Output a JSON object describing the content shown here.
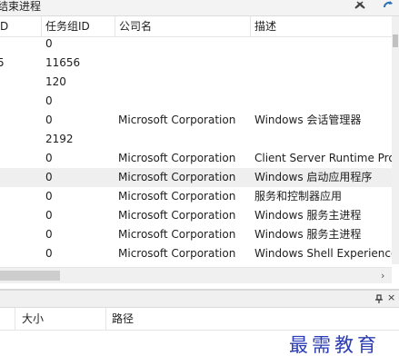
{
  "toolbar": {
    "label": "结束进程",
    "icons": [
      "kill-process-icon",
      "refresh-icon"
    ]
  },
  "table": {
    "columns": [
      "D",
      "任务组ID",
      "公司名",
      "描述"
    ],
    "rows": [
      {
        "id": "",
        "task_group": "0",
        "company": "",
        "description": ""
      },
      {
        "id": "5",
        "task_group": "11656",
        "company": "",
        "description": ""
      },
      {
        "id": "",
        "task_group": "120",
        "company": "",
        "description": ""
      },
      {
        "id": "",
        "task_group": "0",
        "company": "",
        "description": ""
      },
      {
        "id": "",
        "task_group": "0",
        "company": "Microsoft Corporation",
        "description": "Windows 会话管理器"
      },
      {
        "id": "",
        "task_group": "2192",
        "company": "",
        "description": ""
      },
      {
        "id": "",
        "task_group": "0",
        "company": "Microsoft Corporation",
        "description": "Client Server Runtime Process"
      },
      {
        "id": "",
        "task_group": "0",
        "company": "Microsoft Corporation",
        "description": "Windows 启动应用程序"
      },
      {
        "id": "",
        "task_group": "0",
        "company": "Microsoft Corporation",
        "description": "服务和控制器应用"
      },
      {
        "id": "",
        "task_group": "0",
        "company": "Microsoft Corporation",
        "description": "Windows 服务主进程"
      },
      {
        "id": "",
        "task_group": "0",
        "company": "Microsoft Corporation",
        "description": "Windows 服务主进程"
      },
      {
        "id": "",
        "task_group": "0",
        "company": "Microsoft Corporation",
        "description": "Windows Shell Experience"
      }
    ],
    "selected_row": 7
  },
  "lower_panel": {
    "close_label": "×",
    "columns": [
      "大小",
      "路径"
    ]
  },
  "watermark": "最需教育",
  "colors": {
    "selected_row": "#efefef",
    "watermark": "#2b3db4"
  }
}
